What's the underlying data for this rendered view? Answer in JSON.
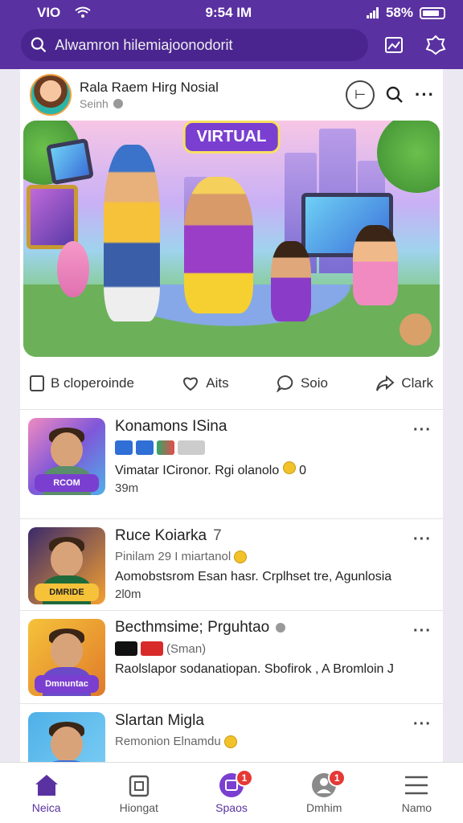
{
  "status": {
    "carrier": "VIO  ",
    "time": "9:54 IM",
    "battery": "58%"
  },
  "search": {
    "placeholder": "Alwamron hilemia­joonodorit"
  },
  "post": {
    "title": "Rala Raem Hirg Nosial",
    "subtitle": "Seinh",
    "hero_tag": "VIRTUAL"
  },
  "actions": [
    {
      "label": "B cloperoinde",
      "icon": "bookmark-icon"
    },
    {
      "label": "Aits",
      "icon": "heart-icon"
    },
    {
      "label": "Soio",
      "icon": "comment-icon"
    },
    {
      "label": "Clark",
      "icon": "share-icon"
    }
  ],
  "items": [
    {
      "name": "Konamons ISina",
      "extra": "",
      "badge_text": "",
      "desc": "Vimatar ICironor.   Rgi olanolo",
      "coin_text": "0",
      "time": "39m",
      "thumb_label": "RCOM",
      "thumb_bg": "#7f57d9"
    },
    {
      "name": "Ruce Koiarka",
      "extra": "7",
      "badge_text": "Pinilam 29 I miartanol",
      "desc": "Aomobstsrom Esan hasr.   Crplhset tre, Agunlosia",
      "coin_text": "",
      "time": "2l0m",
      "thumb_label": "DMRIDE",
      "thumb_bg": "#3a2a6a"
    },
    {
      "name": "Becthmsime; Prguhtao",
      "extra": "",
      "badge_text": "(Sman)",
      "desc": "Raolslapor sodanatiopan.  Sbofirok ,  A Bromloin  J",
      "coin_text": "",
      "time": "",
      "thumb_label": "Dmnuntac",
      "thumb_bg": "#e9a63b"
    },
    {
      "name": "Slartan Migla",
      "extra": "",
      "badge_text": "Remonion Elnamdu",
      "desc": "",
      "coin_text": "",
      "time": "",
      "thumb_label": "",
      "thumb_bg": "#4fb0e8"
    }
  ],
  "nav": [
    {
      "label": "Neica",
      "icon": "home-icon",
      "badge": ""
    },
    {
      "label": "Hiongat",
      "icon": "gift-icon",
      "badge": ""
    },
    {
      "label": "Spaos",
      "icon": "spaces-icon",
      "badge": "1"
    },
    {
      "label": "Dmhim",
      "icon": "profile-icon",
      "badge": "1"
    },
    {
      "label": "Namo",
      "icon": "menu-icon",
      "badge": ""
    }
  ],
  "colors": {
    "brand": "#5a31a1",
    "accent": "#7a3fd0",
    "notif": "#e53935"
  }
}
